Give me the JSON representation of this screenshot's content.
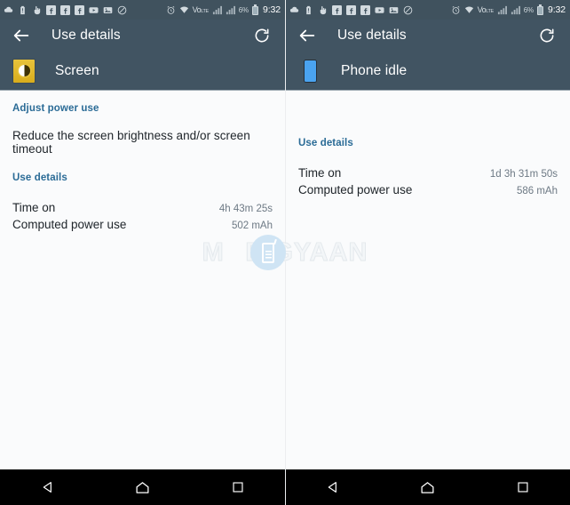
{
  "status_bar": {
    "notification_icons": [
      "cloud-icon",
      "battery-alert-icon",
      "touch-hand-icon",
      "facebook-icon",
      "facebook-icon",
      "facebook-icon",
      "youtube-icon",
      "image-gallery-icon",
      "do-not-disturb-icon"
    ],
    "alarm_icon": "alarm-clock-icon",
    "wifi_icon": "wifi-icon",
    "volte_label": "Vo",
    "volte_sup": "LTE",
    "signal_icons": [
      "signal-bars-icon",
      "signal-bars-icon"
    ],
    "battery_percent": "6%",
    "battery_icon": "battery-icon",
    "time": "9:32"
  },
  "toolbar": {
    "back_icon": "back-arrow-icon",
    "title": "Use details",
    "refresh_icon": "refresh-icon"
  },
  "navbar": {
    "back_label": "back-triangle-icon",
    "home_label": "home-icon",
    "recents_label": "recents-square-icon"
  },
  "watermark": {
    "text_left": "M",
    "text_right": "BIGYAAN",
    "logo": "mobile-phone-logo"
  },
  "left_panel": {
    "app_icon": "screen-brightness-icon",
    "app_name": "Screen",
    "adjust_section": {
      "heading": "Adjust power use",
      "description": "Reduce the screen brightness and/or screen timeout"
    },
    "use_details_heading": "Use details",
    "rows": [
      {
        "key": "Time on",
        "value": "4h 43m 25s"
      },
      {
        "key": "Computed power use",
        "value": "502 mAh"
      }
    ]
  },
  "right_panel": {
    "app_icon": "phone-idle-icon",
    "app_name": "Phone idle",
    "use_details_heading": "Use details",
    "rows": [
      {
        "key": "Time on",
        "value": "1d 3h 31m 50s"
      },
      {
        "key": "Computed power use",
        "value": "586 mAh"
      }
    ]
  },
  "colors": {
    "toolbar": "#415462",
    "status_bar": "#40525e",
    "accent_blue": "#2a6b96",
    "screen_icon": "#d9ad1c",
    "phone_icon": "#4aa3f0",
    "content_bg": "#fafbfc"
  }
}
